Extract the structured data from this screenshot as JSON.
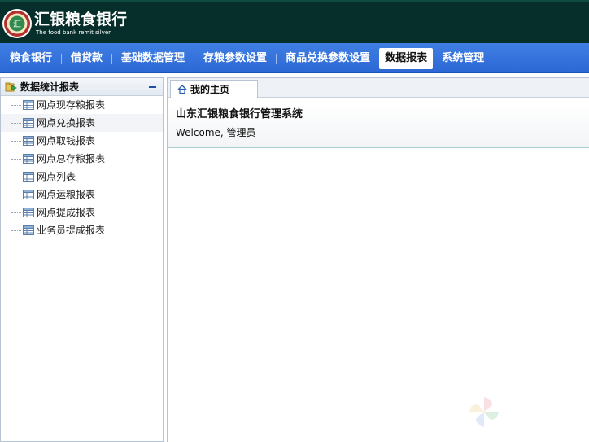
{
  "header": {
    "brand_title": "汇银粮食银行",
    "brand_subtitle": "The food bank remit silver"
  },
  "nav": {
    "items": [
      {
        "label": "粮食银行",
        "active": false
      },
      {
        "label": "借贷款",
        "active": false
      },
      {
        "label": "基础数据管理",
        "active": false
      },
      {
        "label": "存粮参数设置",
        "active": false
      },
      {
        "label": "商品兑换参数设置",
        "active": false
      },
      {
        "label": "数据报表",
        "active": true
      },
      {
        "label": "系统管理",
        "active": false
      }
    ]
  },
  "sidebar": {
    "title": "数据统计报表",
    "items": [
      {
        "label": "网点现存粮报表"
      },
      {
        "label": "网点兑换报表"
      },
      {
        "label": "网点取钱报表"
      },
      {
        "label": "网点总存粮报表"
      },
      {
        "label": "网点列表"
      },
      {
        "label": "网点运粮报表"
      },
      {
        "label": "网点提成报表"
      },
      {
        "label": "业务员提成报表"
      }
    ]
  },
  "main": {
    "tab_label": "我的主页",
    "system_title": "山东汇银粮食银行管理系统",
    "welcome": "Welcome, 管理员"
  },
  "colors": {
    "header_bg": "#062f2b",
    "nav_bg": "#3475dc",
    "nav_active_bg": "#ffffff"
  },
  "icons": {
    "logo": "bank-logo-icon",
    "sidebar_header": "report-folder-icon",
    "tree_item": "table-icon",
    "tab": "home-icon",
    "collapse": "minus-icon"
  }
}
